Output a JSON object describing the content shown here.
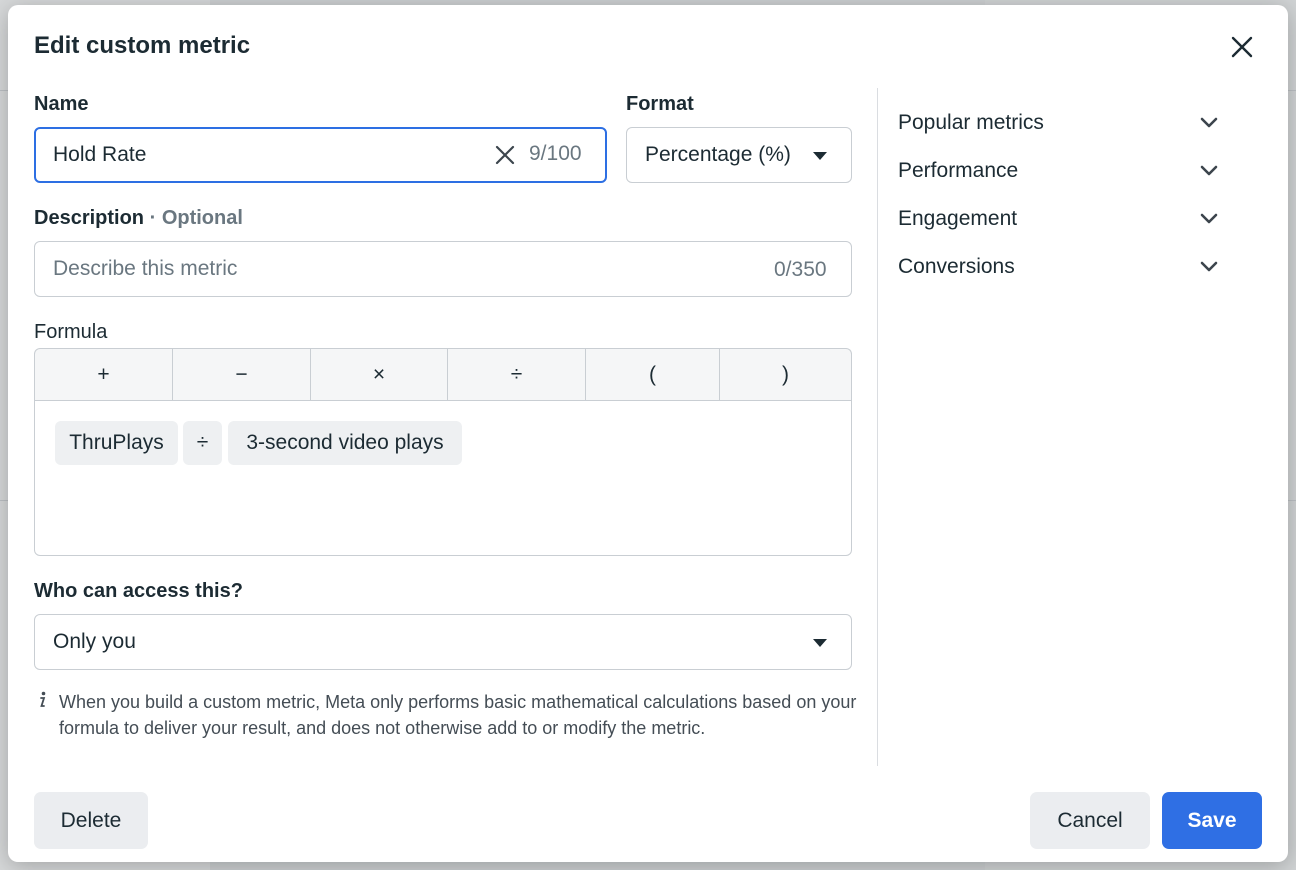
{
  "dialog": {
    "title": "Edit custom metric",
    "close_icon": "close-icon"
  },
  "name_field": {
    "label": "Name",
    "value": "Hold Rate",
    "counter": "9/100",
    "clear_icon": "clear-x-icon"
  },
  "format_field": {
    "label": "Format",
    "selected": "Percentage (%)",
    "icon": "caret-down-icon"
  },
  "description_field": {
    "label": "Description",
    "separator": " · ",
    "optional_label": "Optional",
    "placeholder": "Describe this metric",
    "counter": "0/350"
  },
  "formula": {
    "label": "Formula",
    "operators": [
      "+",
      "−",
      "×",
      "÷",
      "(",
      ")"
    ],
    "tokens": [
      "ThruPlays",
      "÷",
      "3-second video plays"
    ]
  },
  "access": {
    "label": "Who can access this?",
    "selected": "Only you",
    "icon": "caret-down-icon"
  },
  "info": {
    "icon": "info-icon",
    "text": "When you build a custom metric, Meta only performs basic mathematical calculations based on your formula to deliver your result, and does not otherwise add to or modify the metric."
  },
  "metric_categories": [
    {
      "label": "Popular metrics",
      "icon": "chevron-down-icon"
    },
    {
      "label": "Performance",
      "icon": "chevron-down-icon"
    },
    {
      "label": "Engagement",
      "icon": "chevron-down-icon"
    },
    {
      "label": "Conversions",
      "icon": "chevron-down-icon"
    }
  ],
  "footer": {
    "delete_label": "Delete",
    "cancel_label": "Cancel",
    "save_label": "Save"
  },
  "colors": {
    "primary": "#2f6fe4",
    "focus_border": "#2d6fe3",
    "text": "#1c2b33",
    "muted": "#6a7780"
  }
}
